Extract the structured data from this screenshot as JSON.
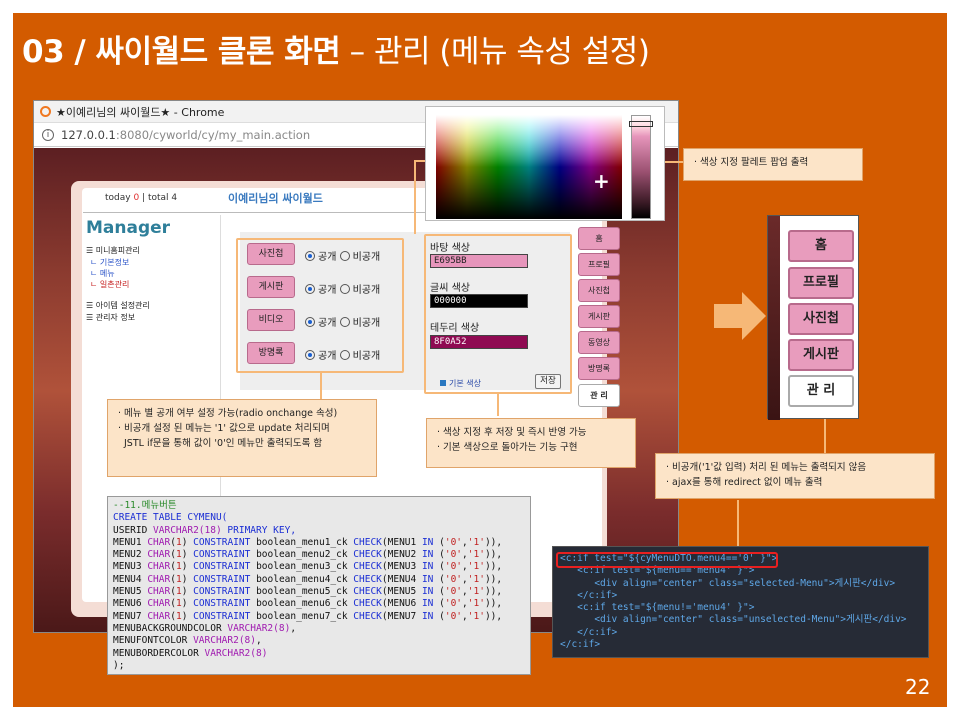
{
  "slide": {
    "title": "03 / 싸이월드 클론 화면",
    "subtitle": " – 관리 (메뉴 속성 설정)",
    "page_number": "22"
  },
  "browser": {
    "window_title": "★이예리님의 싸이월드★ - Chrome",
    "url_host": "127.0.0.1",
    "url_path": ":8080/cyworld/cy/my_main.action"
  },
  "homepage": {
    "today_label": "today ",
    "today_count": "0",
    "total_label": " | total 4",
    "owner_title": "이예리님의 싸이월드",
    "manager_title": "Manager",
    "sidebar": [
      "☰ 미니홈피관리",
      "ㄴ 기본정보",
      "ㄴ 메뉴",
      "ㄴ 일촌관리",
      "☰ 아이템 설정관리",
      "☰ 관리자 정보"
    ]
  },
  "menu_settings": {
    "rows": [
      {
        "label": "사진첩",
        "public": "공개",
        "private": "비공개"
      },
      {
        "label": "게시판",
        "public": "공개",
        "private": "비공개"
      },
      {
        "label": "비디오",
        "public": "공개",
        "private": "비공개"
      },
      {
        "label": "방명록",
        "public": "공개",
        "private": "비공개"
      }
    ],
    "selected": "공개"
  },
  "colors": {
    "bg_label": "바탕 색상",
    "bg_value": "E695BB",
    "bg_color": "#E695BB",
    "font_label": "글씨 색상",
    "font_value": "000000",
    "font_color": "#000000",
    "border_label": "테두리 색상",
    "border_value": "8F0A52",
    "border_color": "#8F0A52",
    "default_link": "기본 색상",
    "ok_button": "저장"
  },
  "right_menu": [
    "홈",
    "프로필",
    "사진첩",
    "게시판",
    "동영상",
    "방명록",
    "관 리"
  ],
  "preview_menu": [
    "홈",
    "프로필",
    "사진첩",
    "게시판",
    "관 리"
  ],
  "notes": {
    "palette": "· 색상 지정 팔레트 팝업 출력",
    "radio": [
      "· 메뉴 별 공개 여부 설정 가능(radio onchange 속성)",
      "· 비공개 설정 된 메뉴는 '1' 값으로 update 처리되며",
      "  JSTL if문을 통해 값이 '0'인 메뉴만 출력되도록 함"
    ],
    "color": [
      "· 색상 지정 후 저장 및 즉시 반영 가능",
      "· 기본 색상으로 돌아가는 기능 구현"
    ],
    "hidden": [
      "· 비공개('1'값 입력) 처리 된 메뉴는 출력되지 않음",
      "· ajax를 통해 redirect 없이 메뉴 출력"
    ]
  },
  "code_sql": {
    "comment": "--11.메뉴버튼",
    "create": "CREATE TABLE CYMENU(",
    "userid_col": "USERID ",
    "userid_type": "VARCHAR2(18)",
    "userid_rest": " PRIMARY KEY,",
    "menus": [
      {
        "col": "MENU1",
        "ck": "boolean_menu1_ck",
        "ref": "MENU1"
      },
      {
        "col": "MENU2",
        "ck": "boolean_menu2_ck",
        "ref": "MENU2"
      },
      {
        "col": "MENU3",
        "ck": "boolean_menu3_ck",
        "ref": "MENU3"
      },
      {
        "col": "MENU4",
        "ck": "boolean_menu4_ck",
        "ref": "MENU4"
      },
      {
        "col": "MENU5",
        "ck": "boolean_menu5_ck",
        "ref": "MENU5"
      },
      {
        "col": "MENU6",
        "ck": "boolean_menu6_ck",
        "ref": "MENU6"
      },
      {
        "col": "MENU7",
        "ck": "boolean_menu7_ck",
        "ref": "MENU7"
      }
    ],
    "extras": [
      {
        "col": "MENUBACKGROUNDCOLOR ",
        "type": "VARCHAR2(8)",
        "tail": ","
      },
      {
        "col": "MENUFONTCOLOR ",
        "type": "VARCHAR2(8)",
        "tail": ","
      },
      {
        "col": "MENUBORDERCOLOR ",
        "type": "VARCHAR2(8)",
        "tail": ""
      }
    ],
    "close": ");"
  },
  "code_jstl": [
    "<c:if test=\"${cyMenuDTO.menu4=='0' }\">",
    "   <c:if test=\"${menu=='menu4' }\">",
    "      <div align=\"center\" class=\"selected-Menu\">게시판</div>",
    "   </c:if>",
    "   <c:if test=\"${menu!='menu4' }\">",
    "      <div align=\"center\" class=\"unselected-Menu\">게시판</div>",
    "   </c:if>",
    "</c:if>"
  ],
  "theme": {
    "slide_bg": "#D35B00",
    "callout_border": "#F6B877",
    "callout_bg": "#FCE4C8",
    "menu_pink": "#E89CBD"
  }
}
